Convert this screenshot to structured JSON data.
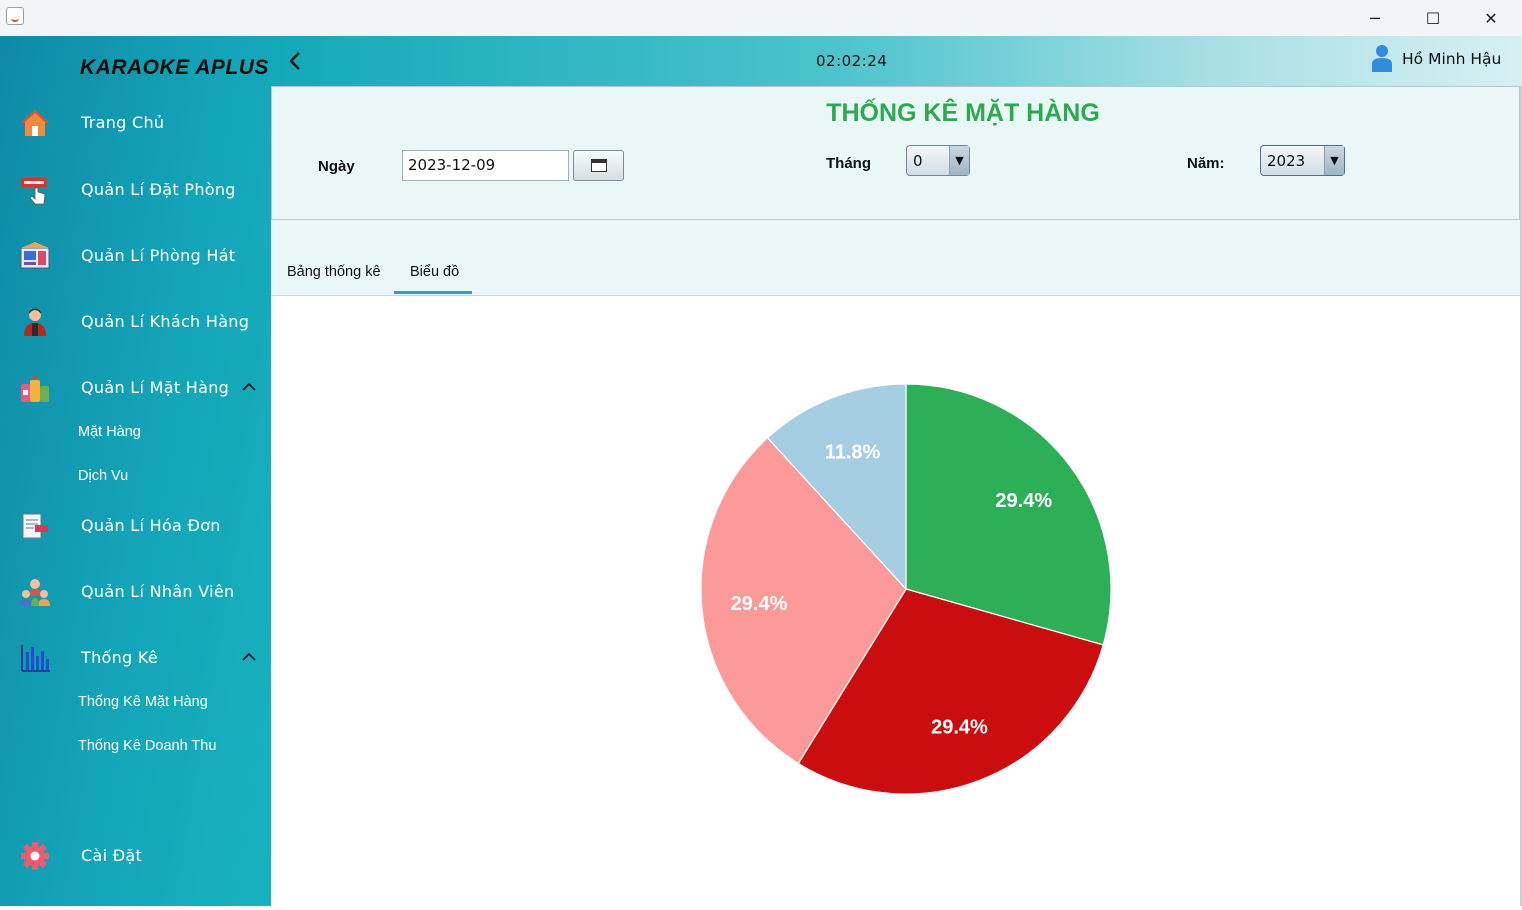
{
  "app": {
    "brand": "KARAOKE APLUS"
  },
  "window": {
    "minimize": "─",
    "maximize": "☐",
    "close": "✕"
  },
  "sidebar": {
    "items": [
      {
        "label": "Trang Chủ",
        "icon": "home-icon"
      },
      {
        "label": "Quản Lí Đặt Phòng",
        "icon": "book-room-icon"
      },
      {
        "label": "Quản Lí Phòng Hát",
        "icon": "karaoke-room-icon"
      },
      {
        "label": "Quản Lí Khách Hàng",
        "icon": "customer-icon"
      },
      {
        "label": "Quản Lí Mặt Hàng",
        "icon": "products-icon"
      },
      {
        "label": "Quản Lí Hóa Đơn",
        "icon": "invoice-icon"
      },
      {
        "label": "Quản Lí Nhân Viên",
        "icon": "staff-icon"
      },
      {
        "label": "Thống Kê",
        "icon": "statistics-icon"
      },
      {
        "label": "Cài Đặt",
        "icon": "settings-icon"
      }
    ],
    "products_sub": [
      "Mặt Hàng",
      "Dịch Vu"
    ],
    "statistics_sub": [
      "Thống Kê Mặt Hàng",
      "Thống Kê Doanh Thu"
    ]
  },
  "header": {
    "clock": "02:02:24",
    "user": "Hồ Minh Hậu"
  },
  "filters": {
    "title": "THỐNG KÊ MẶT HÀNG",
    "date_label": "Ngày",
    "date_value": "2023-12-09",
    "month_label": "Tháng",
    "month_value": "0",
    "year_label": "Năm:",
    "year_value": "2023"
  },
  "tabs": {
    "table_tab": "Bảng thống kê",
    "chart_tab": "Biểu đồ",
    "active": "Biểu đồ"
  },
  "chart_data": {
    "type": "pie",
    "slices": [
      {
        "label": "29.4%",
        "value": 29.4,
        "color": "#2caf57"
      },
      {
        "label": "29.4%",
        "value": 29.4,
        "color": "#cc0d10"
      },
      {
        "label": "29.4%",
        "value": 29.4,
        "color": "#fb9a99"
      },
      {
        "label": "11.8%",
        "value": 11.8,
        "color": "#a6cee3"
      }
    ]
  },
  "colors": {
    "sidebar": "#14a5b8",
    "title_green": "#2caa50",
    "tab_underline": "#2f9fd3"
  }
}
